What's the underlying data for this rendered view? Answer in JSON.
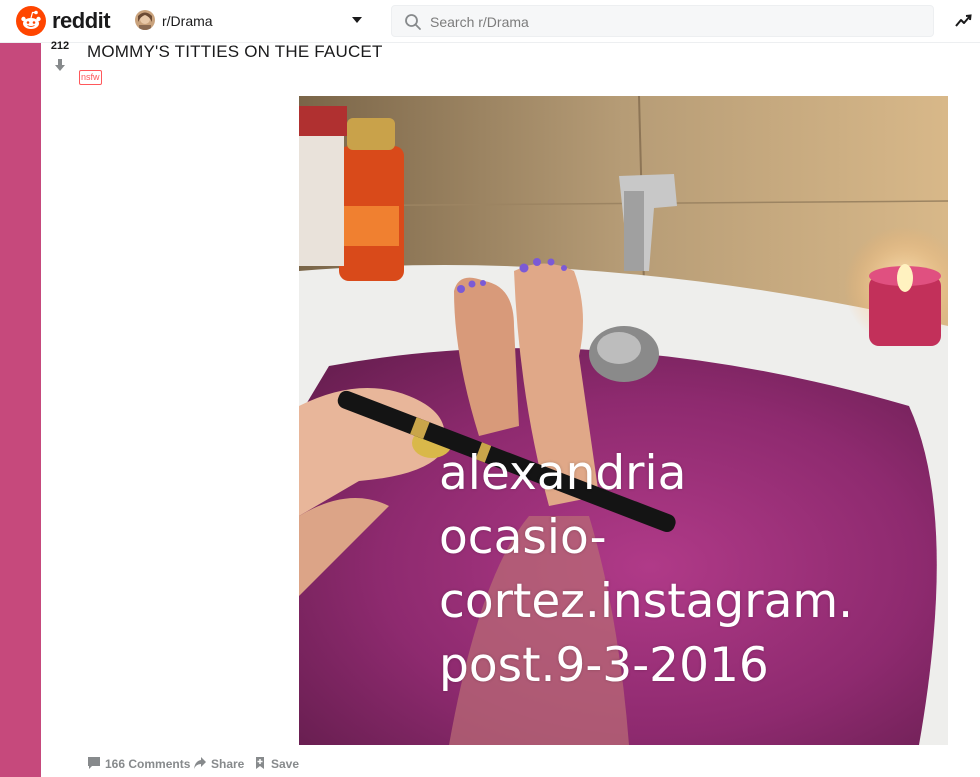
{
  "header": {
    "logo_text": "reddit",
    "subreddit": "r/Drama",
    "search_placeholder": "Search r/Drama"
  },
  "post": {
    "score": "212",
    "title": "MOMMY'S TITTIES ON THE FAUCET",
    "flair": "nsfw",
    "image_overlay_text": "alexandria\nocasio-\ncortez.instagram.\npost.9-3-2016",
    "actions": {
      "comments": "166 Comments",
      "share": "Share",
      "save": "Save"
    }
  },
  "colors": {
    "brand": "#ff4500",
    "rail": "#c6497c",
    "nsfw": "#ff585b"
  },
  "icons": [
    "reddit-logo-icon",
    "chevron-down-icon",
    "search-icon",
    "trending-icon",
    "downvote-icon",
    "comment-icon",
    "share-icon",
    "save-icon"
  ]
}
